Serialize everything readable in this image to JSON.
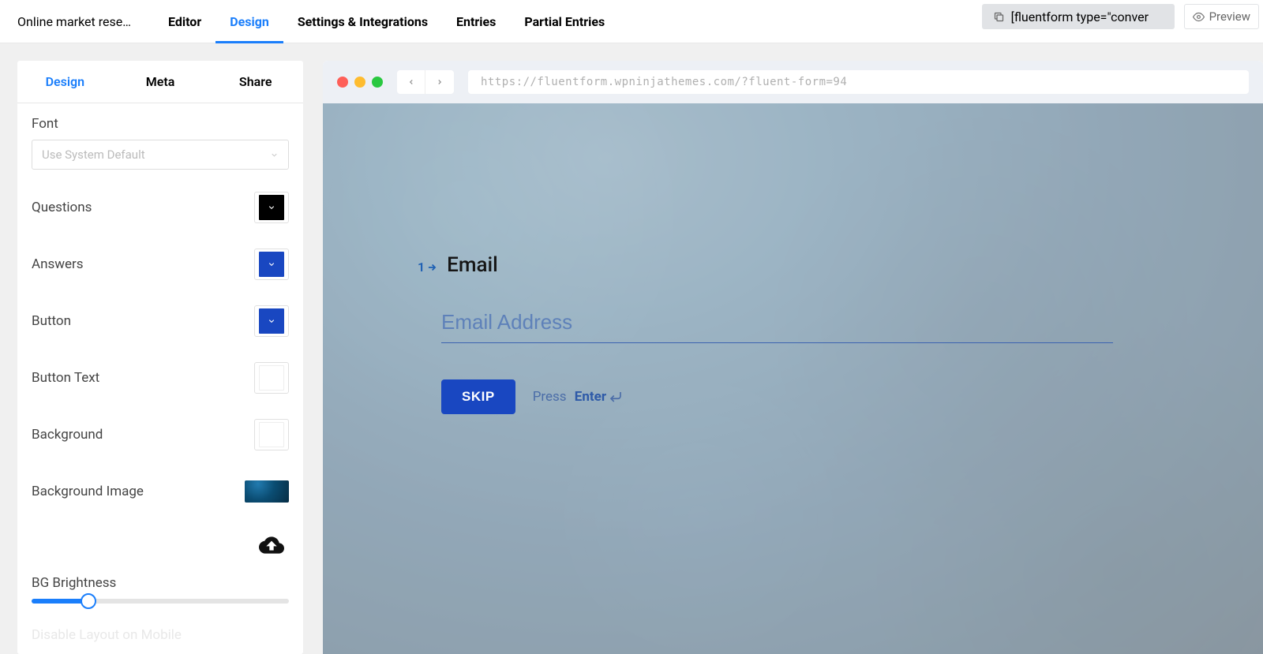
{
  "header": {
    "form_title": "Online market rese…",
    "tabs": [
      "Editor",
      "Design",
      "Settings & Integrations",
      "Entries",
      "Partial Entries"
    ],
    "active_tab_index": 1,
    "shortcode": "[fluentform type=\"conver",
    "preview_label": "Preview"
  },
  "sidebar": {
    "tabs": [
      "Design",
      "Meta",
      "Share"
    ],
    "active_tab_index": 0,
    "font_label": "Font",
    "font_placeholder": "Use System Default",
    "colors": [
      {
        "label": "Questions",
        "value": "#000000",
        "chevron": "#ffffff"
      },
      {
        "label": "Answers",
        "value": "#1947c1",
        "chevron": "#ffffff"
      },
      {
        "label": "Button",
        "value": "#1947c1",
        "chevron": "#ffffff"
      },
      {
        "label": "Button Text",
        "value": "#ffffff",
        "chevron": "#ffffff"
      },
      {
        "label": "Background",
        "value": "#ffffff",
        "chevron": "#ffffff"
      }
    ],
    "bg_image_label": "Background Image",
    "bg_brightness_label": "BG Brightness",
    "bg_brightness_percent": 22,
    "disable_layout_label": "Disable Layout on Mobile"
  },
  "preview": {
    "url": "https://fluentform.wpninjathemes.com/?fluent-form=94",
    "question_number": "1",
    "question_label": "Email",
    "input_placeholder": "Email Address",
    "skip_label": "SKIP",
    "hint_prefix": "Press",
    "hint_key": "Enter"
  }
}
